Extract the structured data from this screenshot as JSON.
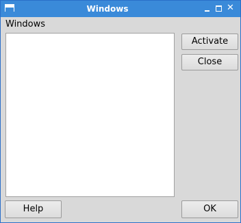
{
  "window": {
    "title": "Windows"
  },
  "main": {
    "section_label": "Windows",
    "window_list_items": []
  },
  "buttons": {
    "activate": "Activate",
    "close": "Close",
    "help": "Help",
    "ok": "OK"
  },
  "icons": {
    "app": "window-icon",
    "minimize": "minimize-icon",
    "maximize": "maximize-icon",
    "close": "close-icon"
  },
  "colors": {
    "titlebar": "#3a8ad9",
    "window_bg": "#d9d9d9",
    "list_bg": "#ffffff"
  }
}
